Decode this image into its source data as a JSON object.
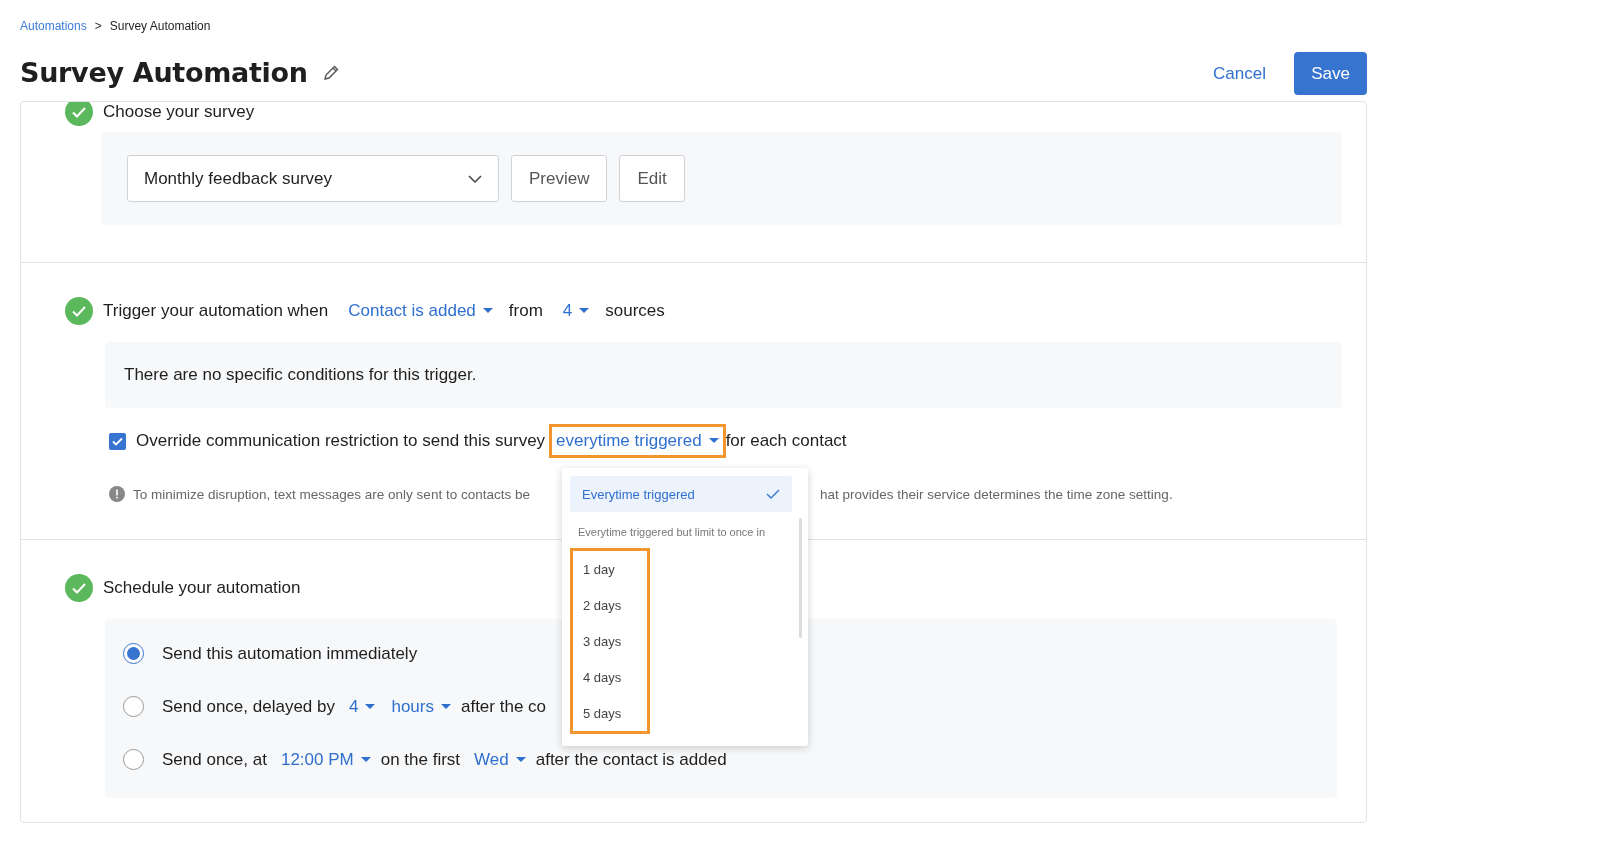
{
  "breadcrumb": [
    {
      "label": "Automations",
      "link": true
    },
    {
      "label": "Survey Automation",
      "link": false
    }
  ],
  "breadcrumb_separator": ">",
  "title": "Survey Automation",
  "actions": {
    "cancel": "Cancel",
    "save": "Save"
  },
  "survey_section": {
    "heading": "Choose your survey",
    "survey_select": "Monthly feedback survey",
    "buttons": [
      "Preview",
      "Edit"
    ],
    "done": true
  },
  "trigger_section": {
    "done": true,
    "parts": [
      {
        "kind": "text",
        "text": "Trigger your automation when"
      },
      {
        "kind": "menu",
        "text": "Contact is added"
      },
      {
        "kind": "text",
        "text": "from"
      },
      {
        "kind": "menu",
        "text": "4"
      },
      {
        "kind": "text",
        "text": "sources"
      }
    ],
    "conditions": "There are no specific conditions for this trigger.",
    "override": {
      "checked": true,
      "label": "Override communication restriction to send this survey",
      "menu": "everytime triggered",
      "highlighted": true,
      "suffix": "for each contact"
    },
    "note": [
      "To minimize disruption, text messages are only sent to contacts be",
      "hat provides their service determines the time zone setting."
    ]
  },
  "frequency_menu": {
    "options": [
      {
        "label": "Everytime triggered",
        "selected": true
      }
    ],
    "group_label": "Everytime triggered but limit to once in",
    "days_highlighted": true,
    "days": [
      {
        "label": "1 day",
        "selected": false
      },
      {
        "label": "2 days",
        "selected": false
      },
      {
        "label": "3 days",
        "selected": false
      },
      {
        "label": "4 days",
        "selected": false
      },
      {
        "label": "5 days",
        "selected": false
      }
    ]
  },
  "schedule_section": {
    "heading": "Schedule your automation",
    "done": true,
    "options": [
      {
        "selected": true,
        "parts": [
          {
            "kind": "text",
            "text": "Send this automation immediately"
          }
        ]
      },
      {
        "selected": false,
        "parts": [
          {
            "kind": "text",
            "text": "Send once, delayed by"
          },
          {
            "kind": "menu",
            "text": "4"
          },
          {
            "kind": "menu",
            "text": "hours"
          },
          {
            "kind": "text",
            "text": "after the co"
          }
        ]
      },
      {
        "selected": false,
        "parts": [
          {
            "kind": "text",
            "text": "Send once, at"
          },
          {
            "kind": "menu",
            "text": "12:00 PM"
          },
          {
            "kind": "text",
            "text": "on the first"
          },
          {
            "kind": "menu",
            "text": "Wed"
          },
          {
            "kind": "text",
            "text": "after the contact is added"
          }
        ]
      }
    ]
  }
}
